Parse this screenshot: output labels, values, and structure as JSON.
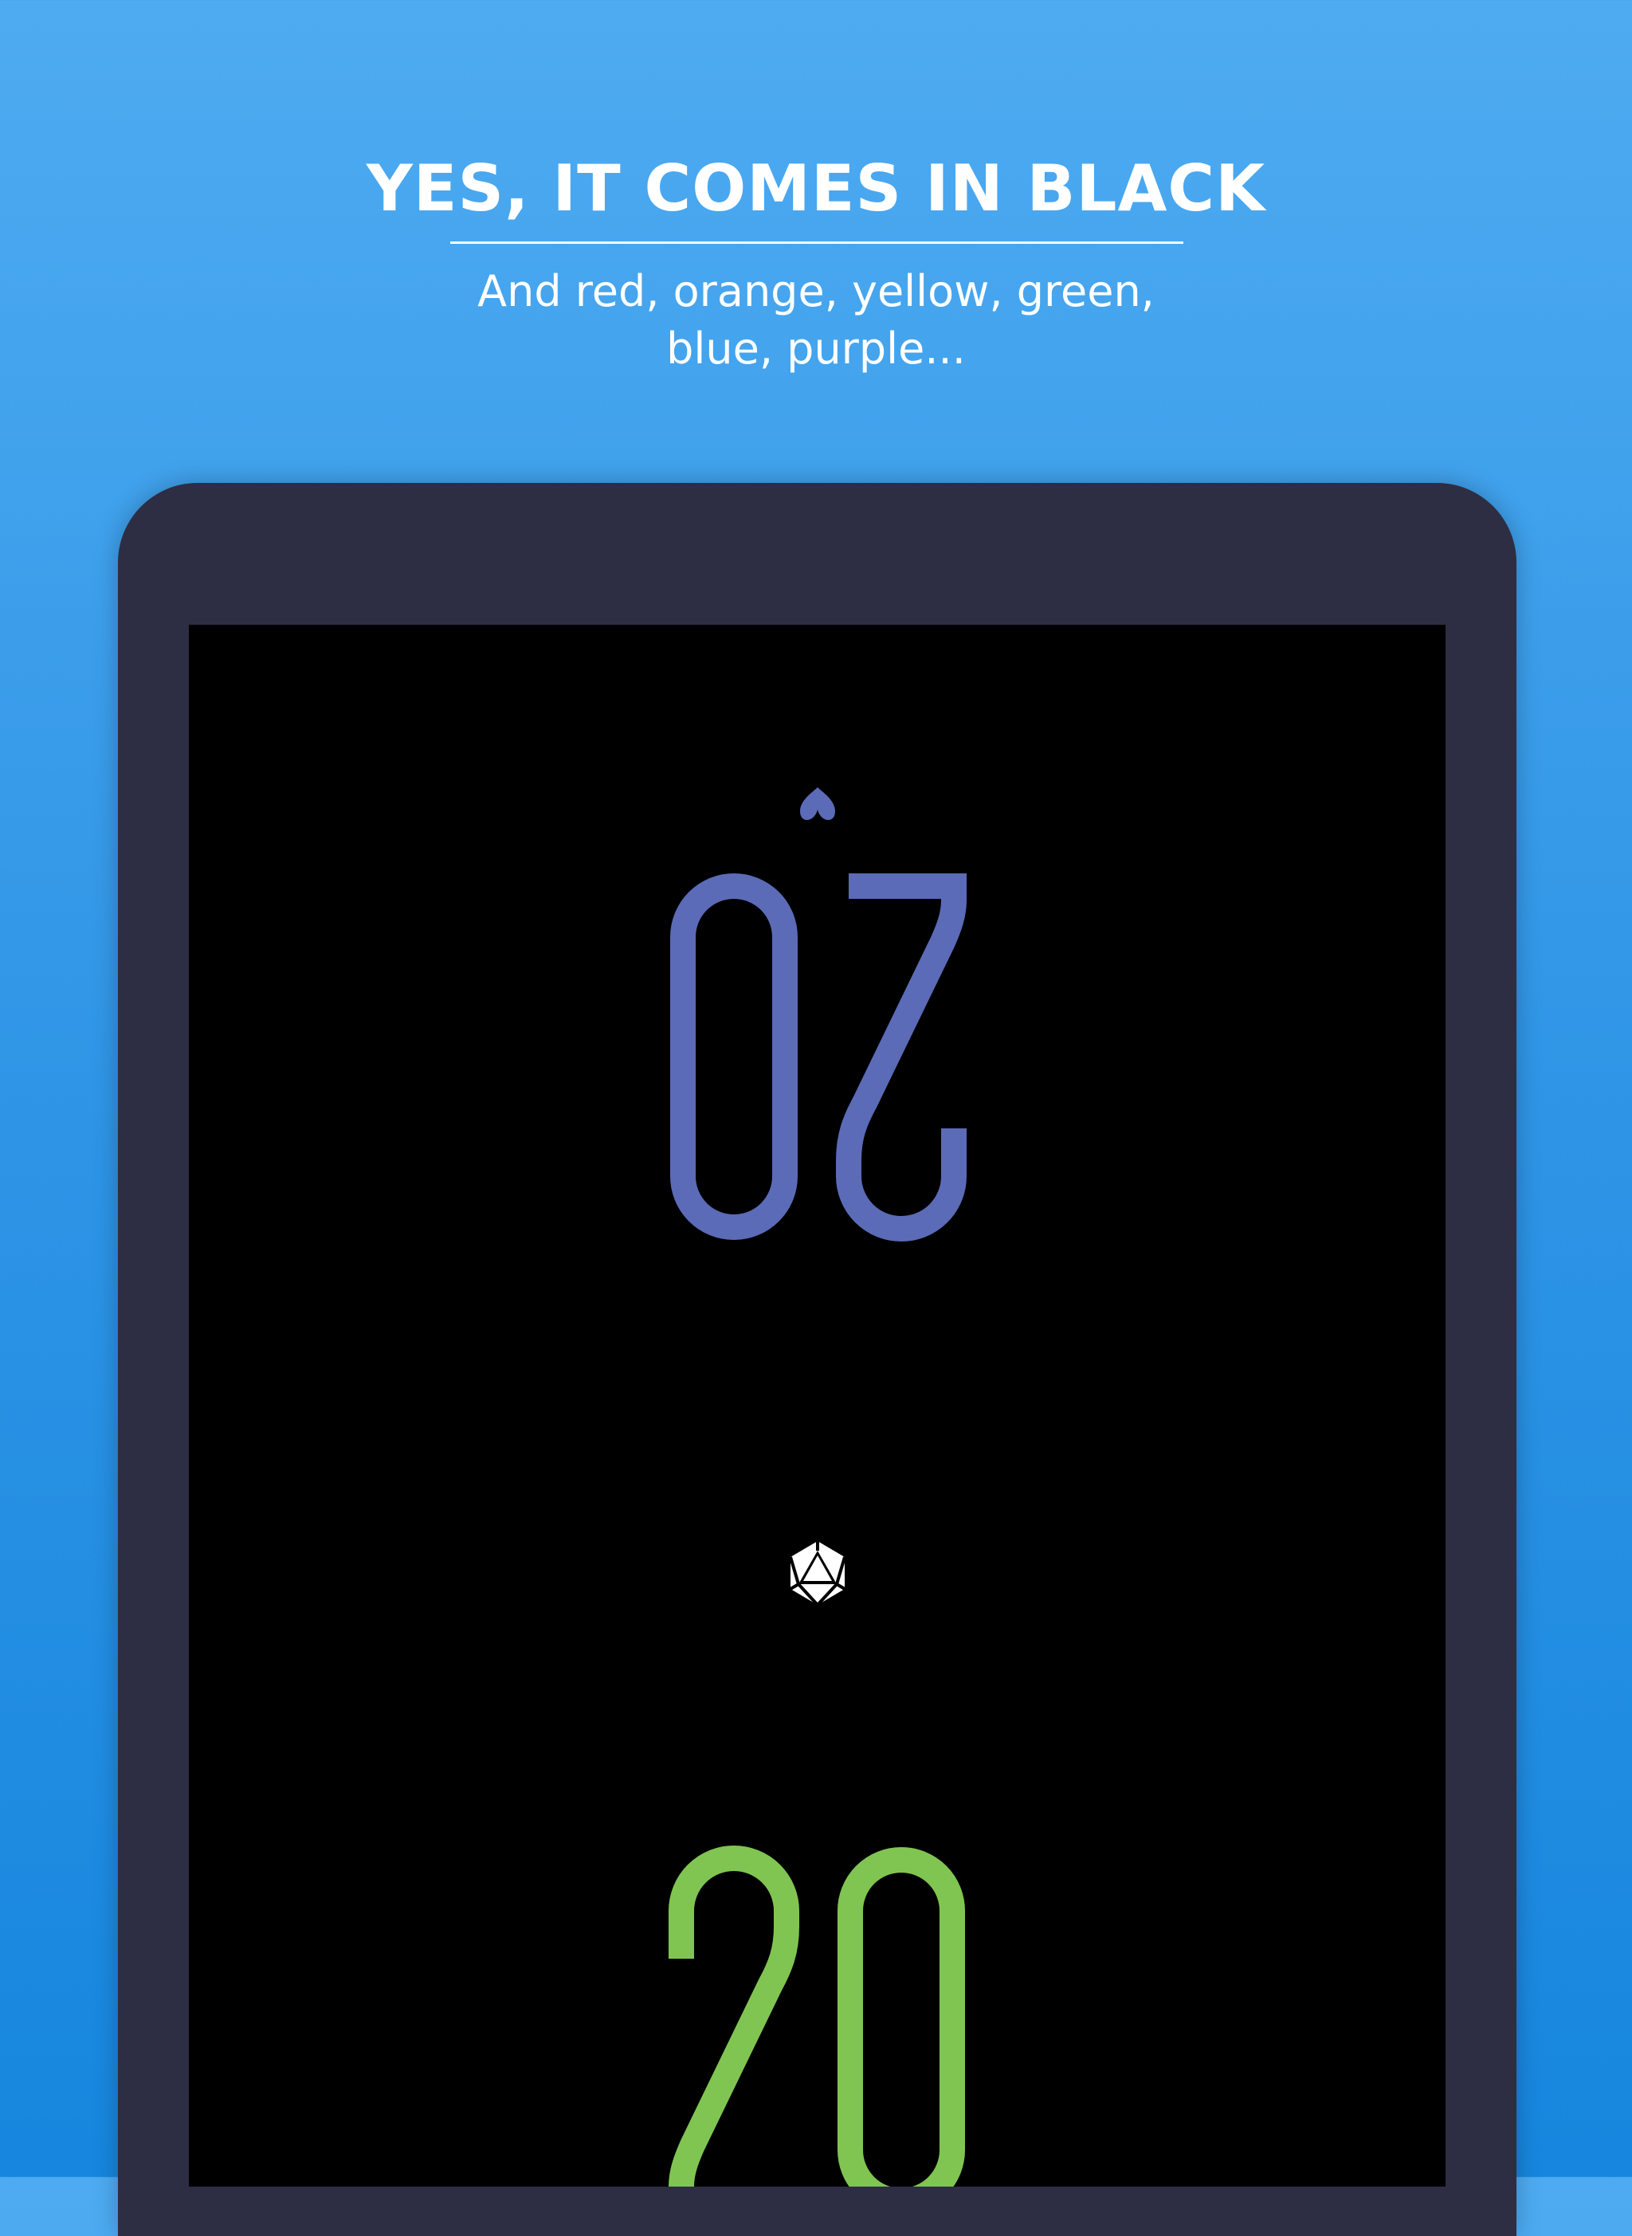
{
  "header": {
    "title": "YES, IT COMES IN BLACK",
    "subtitle_line1": "And red, orange, yellow, green,",
    "subtitle_line2": "blue, purple..."
  },
  "device": {
    "top_player": {
      "life": "20",
      "color": "#5b6bb7",
      "orientation": "rotated-180"
    },
    "bottom_player": {
      "life": "20",
      "color": "#80c552"
    },
    "icons": {
      "player_icon": "heart-icon",
      "center_icon": "d20-dice-icon"
    }
  },
  "colors": {
    "background_top": "#4eabf1",
    "background_bottom": "#1686de",
    "device_frame": "#2d2e43",
    "screen": "#000000"
  }
}
